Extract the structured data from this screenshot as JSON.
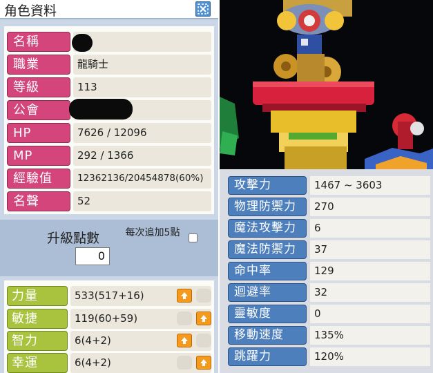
{
  "window": {
    "title": "角色資料"
  },
  "info": [
    {
      "key": "name",
      "label": "名稱",
      "value": "",
      "redacted": true
    },
    {
      "key": "job",
      "label": "職業",
      "value": "龍騎士"
    },
    {
      "key": "level",
      "label": "等級",
      "value": "113"
    },
    {
      "key": "guild",
      "label": "公會",
      "value": "",
      "redacted": true
    },
    {
      "key": "hp",
      "label": "HP",
      "value": "7626 / 12096"
    },
    {
      "key": "mp",
      "label": "MP",
      "value": "292 / 1366"
    },
    {
      "key": "exp",
      "label": "經驗值",
      "value": "12362136/20454878(60%)"
    },
    {
      "key": "fame",
      "label": "名聲",
      "value": "52"
    }
  ],
  "ability_points": {
    "label": "升級點數",
    "value": "0",
    "auto_add_label": "每次追加5點",
    "auto_add_checked": false
  },
  "stats": [
    {
      "key": "str",
      "label": "力量",
      "value": "533(517+16)",
      "up_position": "left"
    },
    {
      "key": "dex",
      "label": "敏捷",
      "value": "119(60+59)",
      "up_position": "right"
    },
    {
      "key": "int",
      "label": "智力",
      "value": "6(4+2)",
      "up_position": "left"
    },
    {
      "key": "luk",
      "label": "幸運",
      "value": "6(4+2)",
      "up_position": "right"
    }
  ],
  "detail_stats": [
    {
      "key": "attack",
      "label": "攻擊力",
      "value": "1467 ~ 3603"
    },
    {
      "key": "weapon_def",
      "label": "物理防禦力",
      "value": "270"
    },
    {
      "key": "magic_atk",
      "label": "魔法攻擊力",
      "value": "6"
    },
    {
      "key": "magic_def",
      "label": "魔法防禦力",
      "value": "37"
    },
    {
      "key": "accuracy",
      "label": "命中率",
      "value": "129"
    },
    {
      "key": "avoid",
      "label": "迴避率",
      "value": "32"
    },
    {
      "key": "hands",
      "label": "靈敏度",
      "value": "0"
    },
    {
      "key": "speed",
      "label": "移動速度",
      "value": "135%"
    },
    {
      "key": "jump",
      "label": "跳躍力",
      "value": "120%"
    }
  ],
  "colors": {
    "info_label": "#d4457c",
    "stat_label": "#aac33e",
    "detail_label": "#4e7fbd",
    "up_button": "#f59a1c",
    "close_button": "#4f8fd2"
  },
  "icons": {
    "close": "close-icon",
    "up": "arrow-up-icon"
  }
}
